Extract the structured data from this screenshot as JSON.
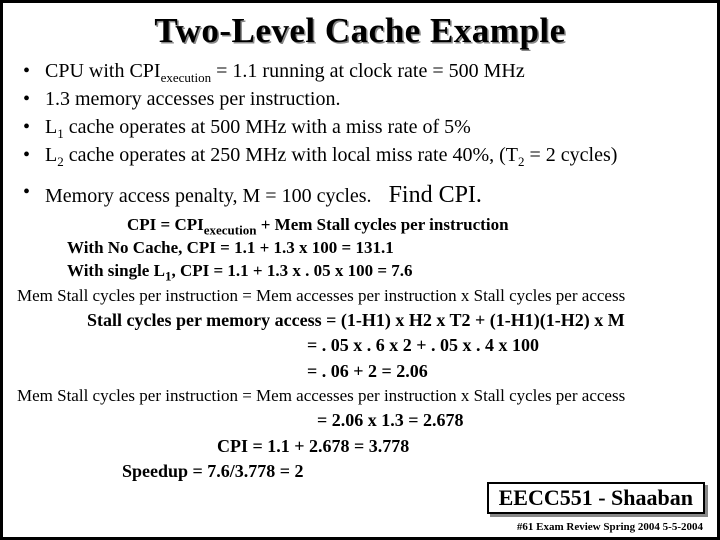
{
  "title": "Two-Level Cache Example",
  "bullets": {
    "b1a": "CPU with CPI",
    "b1_sub": "execution",
    "b1b": " = 1.1  running at clock rate = 500 MHz",
    "b2": "1.3 memory accesses per instruction.",
    "b3a": "L",
    "b3_sub": "1",
    "b3b": " cache operates at 500 MHz with a miss rate of 5%",
    "b4a": "L",
    "b4_sub": "2",
    "b4b": " cache operates at 250 MHz with local miss rate  40%,  (T",
    "b4_sub2": "2",
    "b4c": " = 2 cycles)",
    "b5": "Memory access penalty,  M = 100 cycles.",
    "find": "Find CPI."
  },
  "calc": {
    "l1a": "CPI =    CPI",
    "l1_sub": "execution",
    "l1b": "  +  Mem Stall  cycles per instruction",
    "l2": "With No Cache,    CPI  =  1.1 +  1.3 x 100  =   131.1",
    "l3a": "With single L",
    "l3_sub": "1",
    "l3b": ",    CPI   = 1.1  +  1.3 x . 05 x 100 =  7.6"
  },
  "mem1": "Mem Stall cycles per instruction =  Mem accesses per instruction  x  Stall cycles per access",
  "stall": {
    "l1": "Stall cycles per memory access =   (1-H1) x H2 x T2    +   (1-H1)(1-H2) x M",
    "l2": "=  . 05 x  . 6  x 2    +    . 05 x  . 4  x   100",
    "l3": "=   . 06  +    2   =   2.06"
  },
  "mem2": "Mem Stall cycles per instruction =  Mem accesses per instruction  x  Stall cycles per access",
  "final": {
    "l1": "=     2.06  x  1.3  =    2.678",
    "l2": "CPI = 1.1 +  2.678  = 3.778",
    "speed": "Speedup  =  7.6/3.778  =   2"
  },
  "course": "EECC551 - Shaaban",
  "footer": "#61   Exam Review  Spring 2004  5-5-2004"
}
